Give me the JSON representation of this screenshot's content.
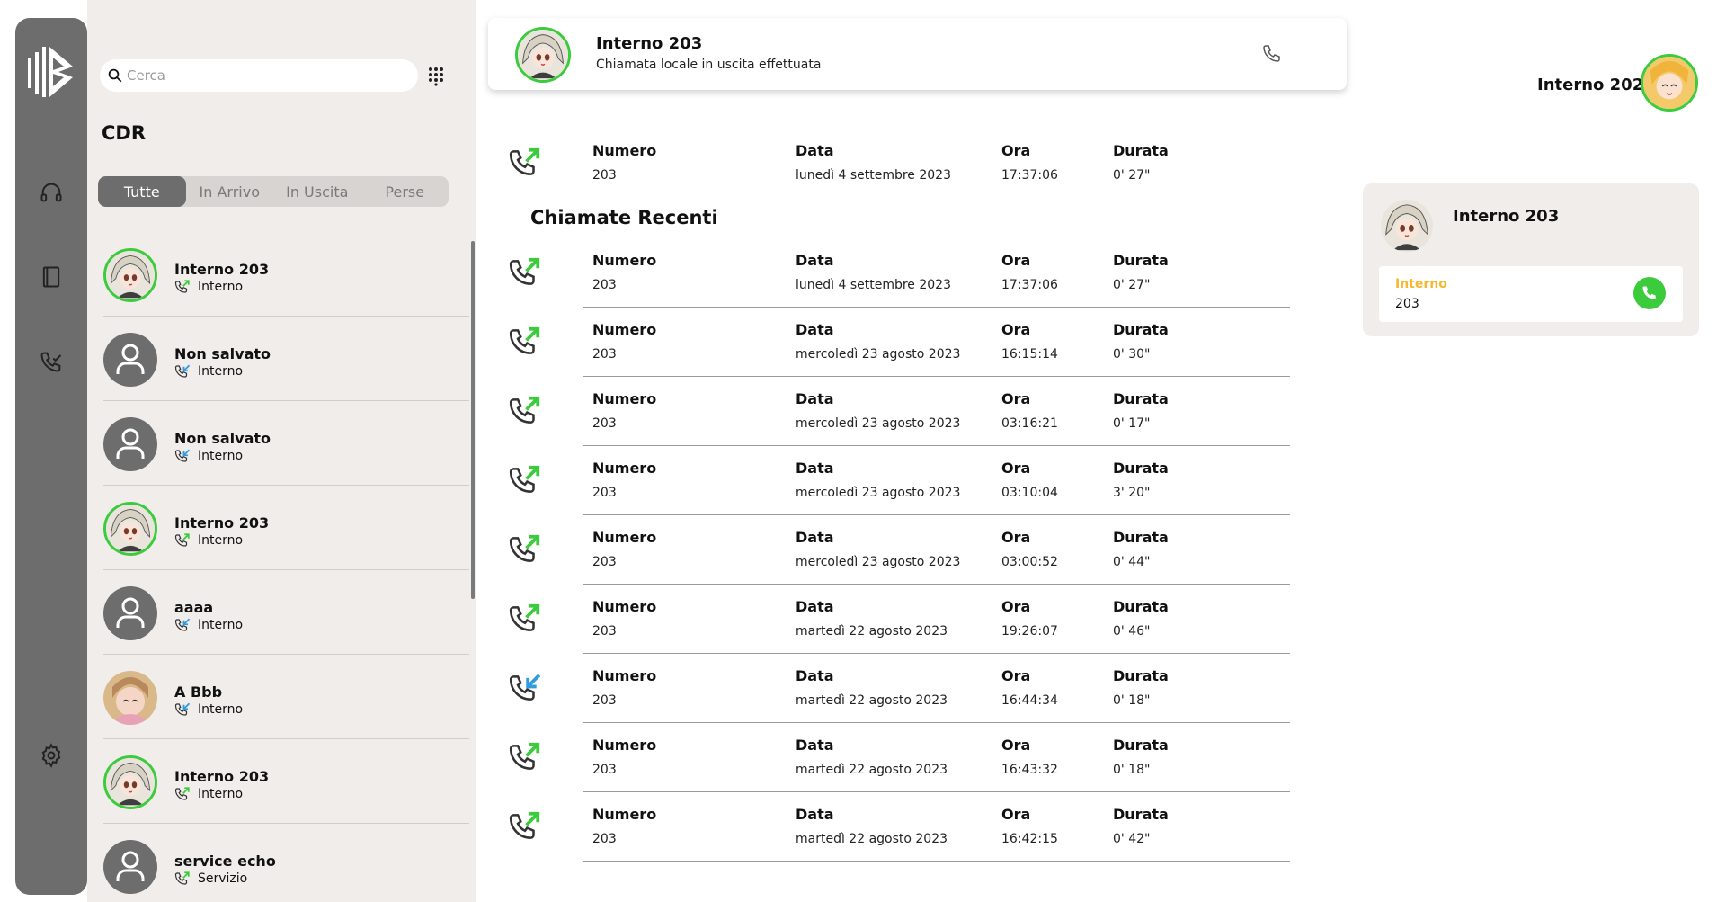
{
  "sidebar": {
    "nav": [
      "headset-icon",
      "book-icon",
      "call-log-icon",
      "gear-icon"
    ]
  },
  "contacts_panel": {
    "search_placeholder": "Cerca",
    "title": "CDR",
    "tabs": [
      "Tutte",
      "In Arrivo",
      "In Uscita",
      "Perse"
    ],
    "active_tab": "Tutte",
    "contacts": [
      {
        "name": "Interno 203",
        "type": "Interno",
        "avatar": "anime",
        "call": "outgoing"
      },
      {
        "name": "Non salvato",
        "type": "Interno",
        "avatar": "default",
        "call": "incoming"
      },
      {
        "name": "Non salvato",
        "type": "Interno",
        "avatar": "default",
        "call": "incoming"
      },
      {
        "name": "Interno 203",
        "type": "Interno",
        "avatar": "anime",
        "call": "outgoing"
      },
      {
        "name": "aaaa",
        "type": "Interno",
        "avatar": "default",
        "call": "incoming"
      },
      {
        "name": "A Bbb",
        "type": "Interno",
        "avatar": "anime2",
        "call": "incoming"
      },
      {
        "name": "Interno 203",
        "type": "Interno",
        "avatar": "anime",
        "call": "outgoing"
      },
      {
        "name": "service echo",
        "type": "Servizio",
        "avatar": "default",
        "call": "outgoing"
      }
    ]
  },
  "header": {
    "name": "Interno 203",
    "subtitle": "Chiamata locale in uscita effettuata"
  },
  "labels": {
    "numero": "Numero",
    "data": "Data",
    "ora": "Ora",
    "durata": "Durata"
  },
  "current_call": {
    "numero": "203",
    "data": "lunedì 4 settembre 2023",
    "ora": "17:37:06",
    "durata": "0' 27\"",
    "direction": "outgoing"
  },
  "recent_title": "Chiamate Recenti",
  "recent_calls": [
    {
      "numero": "203",
      "data": "lunedì 4 settembre 2023",
      "ora": "17:37:06",
      "durata": "0' 27\"",
      "direction": "outgoing"
    },
    {
      "numero": "203",
      "data": "mercoledì 23 agosto 2023",
      "ora": "16:15:14",
      "durata": "0' 30\"",
      "direction": "outgoing"
    },
    {
      "numero": "203",
      "data": "mercoledì 23 agosto 2023",
      "ora": "03:16:21",
      "durata": "0' 17\"",
      "direction": "outgoing"
    },
    {
      "numero": "203",
      "data": "mercoledì 23 agosto 2023",
      "ora": "03:10:04",
      "durata": "3' 20\"",
      "direction": "outgoing"
    },
    {
      "numero": "203",
      "data": "mercoledì 23 agosto 2023",
      "ora": "03:00:52",
      "durata": "0' 44\"",
      "direction": "outgoing"
    },
    {
      "numero": "203",
      "data": "martedì 22 agosto 2023",
      "ora": "19:26:07",
      "durata": "0' 46\"",
      "direction": "outgoing"
    },
    {
      "numero": "203",
      "data": "martedì 22 agosto 2023",
      "ora": "16:44:34",
      "durata": "0' 18\"",
      "direction": "incoming"
    },
    {
      "numero": "203",
      "data": "martedì 22 agosto 2023",
      "ora": "16:43:32",
      "durata": "0' 18\"",
      "direction": "outgoing"
    },
    {
      "numero": "203",
      "data": "martedì 22 agosto 2023",
      "ora": "16:42:15",
      "durata": "0' 42\"",
      "direction": "outgoing"
    }
  ],
  "me": {
    "name": "Interno 202"
  },
  "info_card": {
    "name": "Interno 203",
    "label": "Interno",
    "value": "203"
  },
  "colors": {
    "accent_green": "#3ccb3c",
    "outgoing_arrow": "#3ccb3c",
    "incoming_arrow": "#2f9ce0",
    "label_orange": "#f5b82e",
    "rail": "#6d6d6d"
  }
}
